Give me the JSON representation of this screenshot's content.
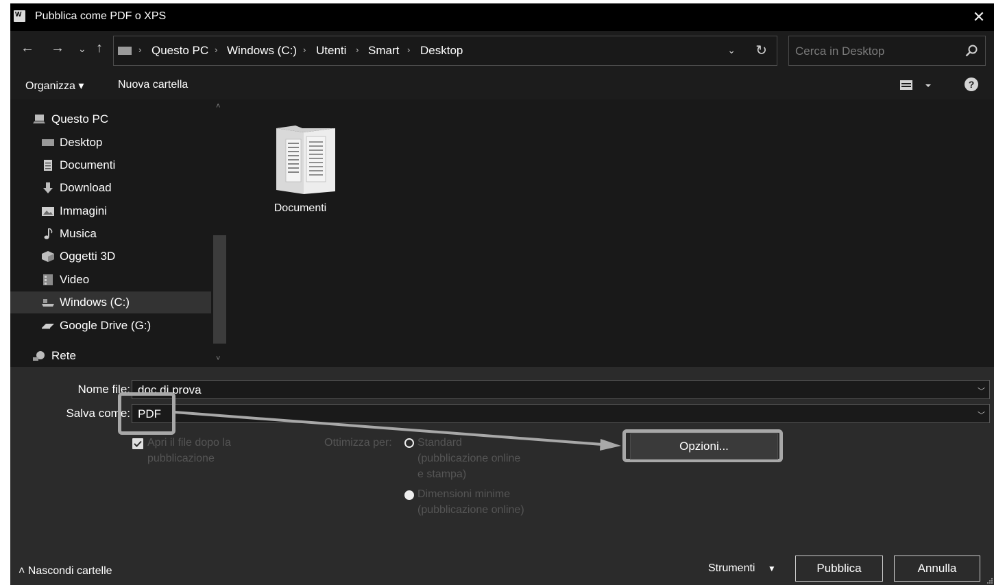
{
  "window": {
    "title": "Pubblica come PDF o XPS",
    "app_icon": "word-doc-icon",
    "close_glyph": "✕"
  },
  "nav": {
    "back": "←",
    "forward": "→",
    "recent": "⌄",
    "up": "↑",
    "breadcrumbs": [
      "Questo PC",
      "Windows (C:)",
      "Utenti",
      "Smart",
      "Desktop"
    ],
    "refresh": "↻",
    "dropdown": "⌄",
    "search_placeholder": "Cerca in Desktop"
  },
  "toolbar": {
    "organize": "Organizza ▾",
    "new_folder": "Nuova cartella",
    "help": "?"
  },
  "sidebar": {
    "items": [
      {
        "label": "Questo PC",
        "icon": "computer-icon"
      },
      {
        "label": "Desktop",
        "icon": "desktop-icon"
      },
      {
        "label": "Documenti",
        "icon": "documents-icon"
      },
      {
        "label": "Download",
        "icon": "download-icon"
      },
      {
        "label": "Immagini",
        "icon": "pictures-icon"
      },
      {
        "label": "Musica",
        "icon": "music-icon"
      },
      {
        "label": "Oggetti 3D",
        "icon": "3d-objects-icon"
      },
      {
        "label": "Video",
        "icon": "video-icon"
      },
      {
        "label": "Windows (C:)",
        "icon": "drive-icon"
      },
      {
        "label": "Google Drive (G:)",
        "icon": "cloud-drive-icon"
      },
      {
        "label": "Rete",
        "icon": "network-icon"
      }
    ],
    "selected_index": 8,
    "scroll_up": "˄",
    "scroll_down": "˅"
  },
  "content": {
    "items": [
      {
        "label": "Documenti",
        "icon": "folder-icon"
      }
    ]
  },
  "form": {
    "filename_label": "Nome file:",
    "filename_value": "doc di prova",
    "saveas_label": "Salva come:",
    "saveas_value": "PDF",
    "open_after_label_1": "Apri il file dopo la",
    "open_after_label_2": "pubblicazione",
    "open_after_checked": true,
    "optimize_label": "Ottimizza per:",
    "radio_standard_1": "Standard",
    "radio_standard_2": "(pubblicazione online",
    "radio_standard_3": "e stampa)",
    "radio_min_1": "Dimensioni minime",
    "radio_min_2": "(pubblicazione online)",
    "options_button": "Opzioni..."
  },
  "footer": {
    "hide_folders": "˄ Nascondi cartelle",
    "tools": "Strumenti",
    "publish": "Pubblica",
    "cancel": "Annulla"
  },
  "colors": {
    "background": "#1c1c1c",
    "titlebar": "#000000",
    "form_bg": "#2b2b2b",
    "highlight": "#a8a8a8"
  }
}
